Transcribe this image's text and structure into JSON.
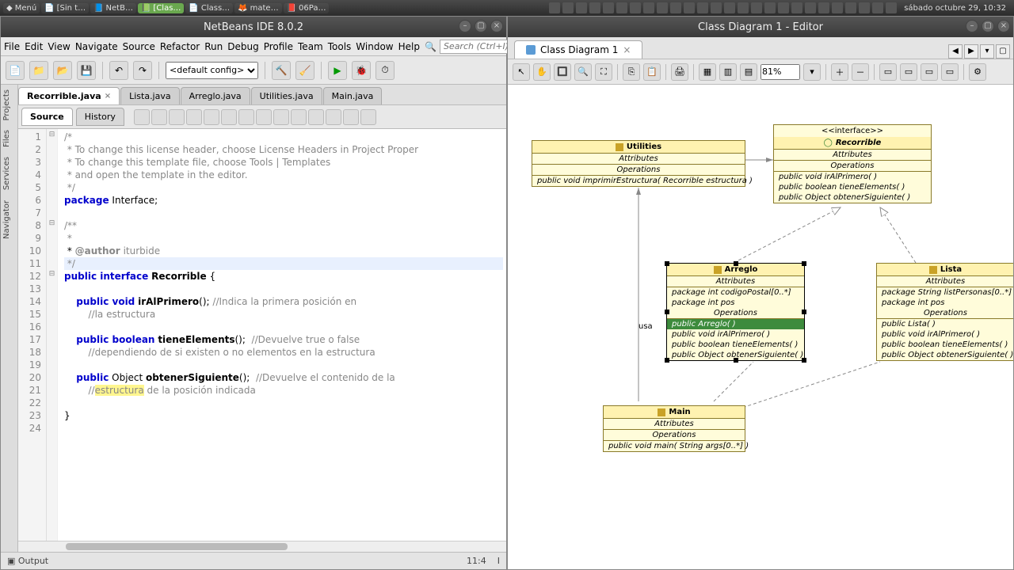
{
  "os": {
    "menu_label": "Menú",
    "task_items": [
      "[Sin t…",
      "NetB…",
      "[Clas…",
      "Class…",
      "mate…",
      "06Pa…"
    ],
    "clock": "sábado octubre 29, 10:32"
  },
  "netbeans": {
    "title": "NetBeans IDE 8.0.2",
    "menus": [
      "File",
      "Edit",
      "View",
      "Navigate",
      "Source",
      "Refactor",
      "Run",
      "Debug",
      "Profile",
      "Team",
      "Tools",
      "Window",
      "Help"
    ],
    "search_placeholder": "Search (Ctrl+I)",
    "config": "<default config>",
    "side_tabs": [
      "Projects",
      "Files",
      "Services",
      "Navigator"
    ],
    "file_tabs": [
      "Recorrible.java",
      "Lista.java",
      "Arreglo.java",
      "Utilities.java",
      "Main.java"
    ],
    "active_file_idx": 0,
    "source_label": "Source",
    "history_label": "History",
    "code": {
      "lines": [
        {
          "n": 1,
          "t": "/*",
          "cls": "cm"
        },
        {
          "n": 2,
          "t": " * To change this license header, choose License Headers in Project Proper",
          "cls": "cm"
        },
        {
          "n": 3,
          "t": " * To change this template file, choose Tools | Templates",
          "cls": "cm"
        },
        {
          "n": 4,
          "t": " * and open the template in the editor.",
          "cls": "cm"
        },
        {
          "n": 5,
          "t": " */",
          "cls": "cm"
        },
        {
          "n": 6,
          "html": "<span class='kw'>package</span> Interface;"
        },
        {
          "n": 7,
          "t": ""
        },
        {
          "n": 8,
          "t": "/**",
          "cls": "cm"
        },
        {
          "n": 9,
          "t": " *",
          "cls": "cm"
        },
        {
          "n": 10,
          "html": " * <span class='ann'>@author</span> <span class='cm'>iturbide</span>"
        },
        {
          "n": 11,
          "t": " */",
          "cls": "cm",
          "cur": true
        },
        {
          "n": 12,
          "html": "<span class='kw'>public interface</span> <span class='id'>Recorrible</span> {"
        },
        {
          "n": 13,
          "t": ""
        },
        {
          "n": 14,
          "html": "    <span class='kw'>public void</span> <span class='id'>irAlPrimero</span>(); <span class='cm'>//Indica la primera posición en</span>"
        },
        {
          "n": 15,
          "html": "        <span class='cm'>//la estructura</span>"
        },
        {
          "n": 16,
          "t": ""
        },
        {
          "n": 17,
          "html": "    <span class='kw'>public boolean</span> <span class='id'>tieneElements</span>();  <span class='cm'>//Devuelve true o false</span>"
        },
        {
          "n": 18,
          "html": "        <span class='cm'>//dependiendo de si existen o no elementos en la estructura</span>"
        },
        {
          "n": 19,
          "t": ""
        },
        {
          "n": 20,
          "html": "    <span class='kw'>public</span> Object <span class='id'>obtenerSiguiente</span>();  <span class='cm'>//Devuelve el contenido de la</span>"
        },
        {
          "n": 21,
          "html": "        <span class='cm'>//<span class='hl'>estructura</span> de la posición indicada</span>"
        },
        {
          "n": 22,
          "t": ""
        },
        {
          "n": 23,
          "t": "}"
        },
        {
          "n": 24,
          "t": ""
        }
      ]
    },
    "output_label": "Output",
    "cursor_pos": "11:4",
    "ins": "I"
  },
  "diagram": {
    "title": "Class Diagram 1 - Editor",
    "tab": "Class Diagram 1",
    "zoom": "81%",
    "usa_label": "usa",
    "classes": {
      "utilities": {
        "name": "Utilities",
        "attrs_label": "Attributes",
        "ops_label": "Operations",
        "ops": [
          "public void  imprimirEstructura( Recorrible estructura )"
        ]
      },
      "recorrible": {
        "stereotype": "<<interface>>",
        "name": "Recorrible",
        "attrs_label": "Attributes",
        "ops_label": "Operations",
        "ops": [
          "public void  irAlPrimero(  )",
          "public boolean  tieneElements(  )",
          "public Object  obtenerSiguiente(  )"
        ]
      },
      "arreglo": {
        "name": "Arreglo",
        "attrs_label": "Attributes",
        "attrs": [
          "package int codigoPostal[0..*]",
          "package int pos"
        ],
        "ops_label": "Operations",
        "ops": [
          "public Arreglo(  )",
          "public void  irAlPrimero(  )",
          "public boolean  tieneElements(  )",
          "public Object  obtenerSiguiente(  )"
        ]
      },
      "lista": {
        "name": "Lista",
        "attrs_label": "Attributes",
        "attrs": [
          "package String listPersonas[0..*]",
          "package int pos"
        ],
        "ops_label": "Operations",
        "ops": [
          "public Lista(  )",
          "public void  irAlPrimero(  )",
          "public boolean  tieneElements(  )",
          "public Object  obtenerSiguiente(  )"
        ]
      },
      "main": {
        "name": "Main",
        "attrs_label": "Attributes",
        "ops_label": "Operations",
        "ops": [
          "public void  main( String args[0..*] )"
        ]
      }
    }
  }
}
